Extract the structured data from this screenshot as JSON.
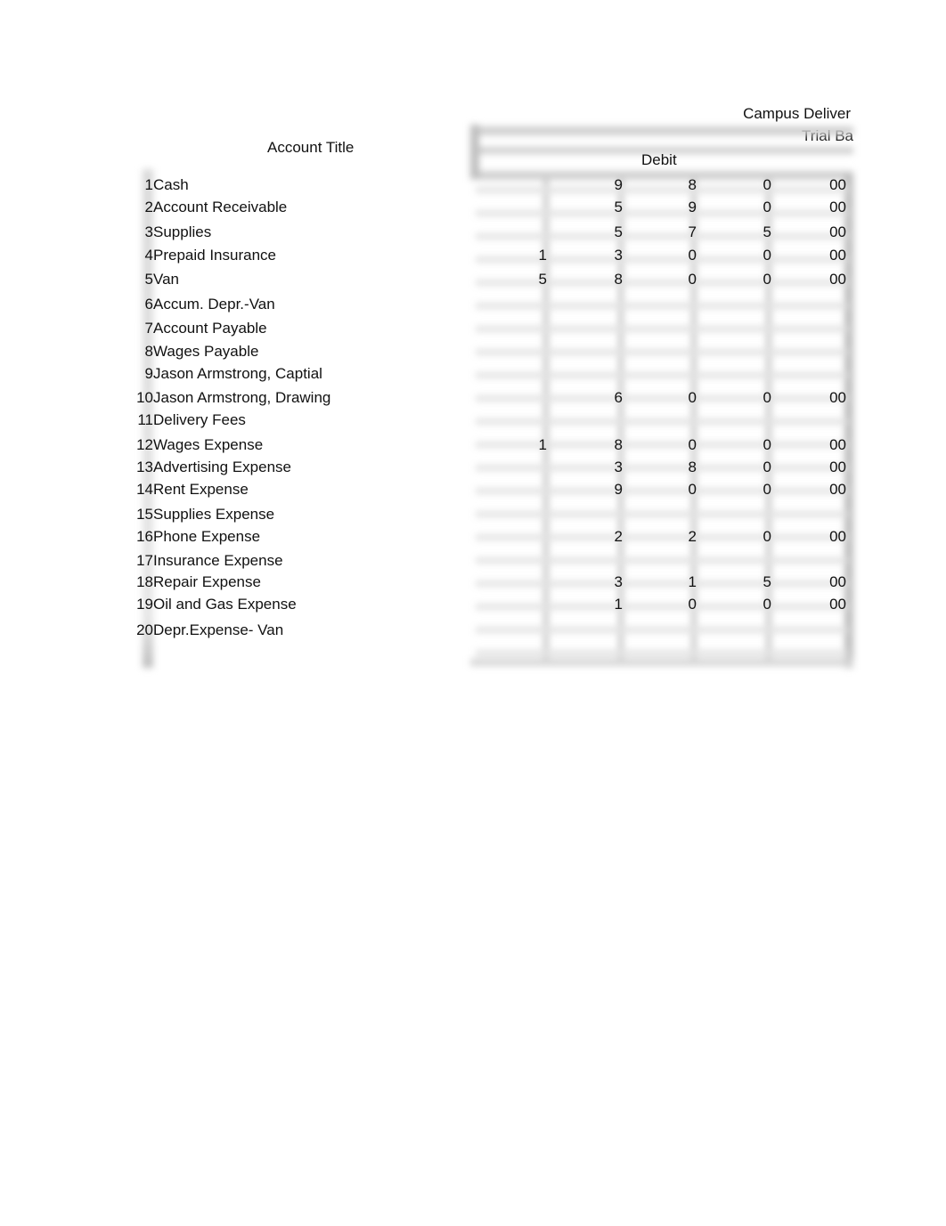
{
  "header": {
    "company": "Campus Deliver",
    "subtitle": "Trial Ba",
    "account_title_label": "Account Title",
    "debit_label": "Debit"
  },
  "rows": [
    {
      "num": "1",
      "title": "Cash",
      "d": [
        "",
        "9",
        "8",
        "0",
        "00"
      ]
    },
    {
      "num": "2",
      "title": "Account Receivable",
      "d": [
        "",
        "5",
        "9",
        "0",
        "00"
      ]
    },
    {
      "num": "3",
      "title": "Supplies",
      "d": [
        "",
        "5",
        "7",
        "5",
        "00"
      ]
    },
    {
      "num": "4",
      "title": "Prepaid Insurance",
      "d": [
        "1",
        "3",
        "0",
        "0",
        "00"
      ]
    },
    {
      "num": "5",
      "title": "Van",
      "d": [
        "5",
        "8",
        "0",
        "0",
        "00"
      ]
    },
    {
      "num": "6",
      "title": "Accum. Depr.-Van",
      "d": [
        "",
        "",
        "",
        "",
        ""
      ]
    },
    {
      "num": "7",
      "title": "Account Payable",
      "d": [
        "",
        "",
        "",
        "",
        ""
      ]
    },
    {
      "num": "8",
      "title": "Wages Payable",
      "d": [
        "",
        "",
        "",
        "",
        ""
      ]
    },
    {
      "num": "9",
      "title": "Jason Armstrong, Captial",
      "d": [
        "",
        "",
        "",
        "",
        ""
      ]
    },
    {
      "num": "10",
      "title": "Jason Armstrong, Drawing",
      "d": [
        "",
        "6",
        "0",
        "0",
        "00"
      ]
    },
    {
      "num": "11",
      "title": "Delivery Fees",
      "d": [
        "",
        "",
        "",
        "",
        ""
      ]
    },
    {
      "num": "12",
      "title": "Wages Expense",
      "d": [
        "1",
        "8",
        "0",
        "0",
        "00"
      ]
    },
    {
      "num": "13",
      "title": "Advertising Expense",
      "d": [
        "",
        "3",
        "8",
        "0",
        "00"
      ]
    },
    {
      "num": "14",
      "title": "Rent Expense",
      "d": [
        "",
        "9",
        "0",
        "0",
        "00"
      ]
    },
    {
      "num": "15",
      "title": "Supplies Expense",
      "d": [
        "",
        "",
        "",
        "",
        ""
      ]
    },
    {
      "num": "16",
      "title": "Phone Expense",
      "d": [
        "",
        "2",
        "2",
        "0",
        "00"
      ]
    },
    {
      "num": "17",
      "title": "Insurance Expense",
      "d": [
        "",
        "",
        "",
        "",
        ""
      ]
    },
    {
      "num": "18",
      "title": "Repair Expense",
      "d": [
        "",
        "3",
        "1",
        "5",
        "00"
      ]
    },
    {
      "num": "19",
      "title": "Oil and Gas Expense",
      "d": [
        "",
        "1",
        "0",
        "0",
        "00"
      ]
    },
    {
      "num": "20",
      "title": "Depr.Expense- Van",
      "d": [
        "",
        "",
        "",
        "",
        ""
      ]
    }
  ]
}
